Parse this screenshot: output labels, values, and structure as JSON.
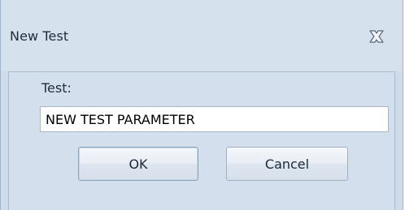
{
  "window": {
    "title": "New Test",
    "close_icon": "close-icon"
  },
  "form": {
    "test_label": "Test:",
    "test_value": "NEW TEST PARAMETER"
  },
  "buttons": {
    "ok_label": "OK",
    "cancel_label": "Cancel"
  },
  "colors": {
    "window_background": "#cfdbe8",
    "titlebar_background": "#d6e1ee",
    "content_background": "#d3dfec",
    "input_background": "#ffffff",
    "text": "#1f2d3d"
  }
}
